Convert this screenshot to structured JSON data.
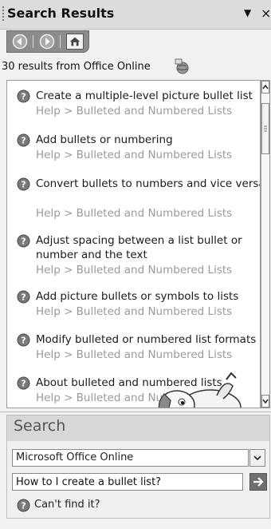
{
  "window": {
    "title": "Search Results"
  },
  "nav": {
    "back_icon": "back-icon",
    "forward_icon": "forward-icon",
    "home_icon": "home-icon"
  },
  "summary": {
    "text": "30 results from Office Online",
    "icon": "office-online-globe-icon"
  },
  "results": [
    {
      "title": "Create a multiple-level picture bullet list",
      "path": "Help > Bulleted and Numbered Lists"
    },
    {
      "title": "Add bullets or numbering",
      "path": "Help > Bulleted and Numbered Lists"
    },
    {
      "title": "Convert bullets to numbers and vice versa",
      "path": "Help > Bulleted and Numbered Lists"
    },
    {
      "title": "Adjust spacing between a list bullet or number and the text",
      "path": "Help > Bulleted and Numbered Lists"
    },
    {
      "title": "Add picture bullets or symbols to lists",
      "path": "Help > Bulleted and Numbered Lists"
    },
    {
      "title": "Modify bulleted or numbered list formats",
      "path": "Help > Bulleted and Numbered Lists"
    },
    {
      "title": "About bulleted and numbered lists",
      "path": "Help > Bulleted and Numbered Lists"
    }
  ],
  "search": {
    "heading": "Search",
    "scope": "Microsoft Office Online",
    "query": "How to I create a bullet list?",
    "cant_find": "Can't find it?"
  }
}
